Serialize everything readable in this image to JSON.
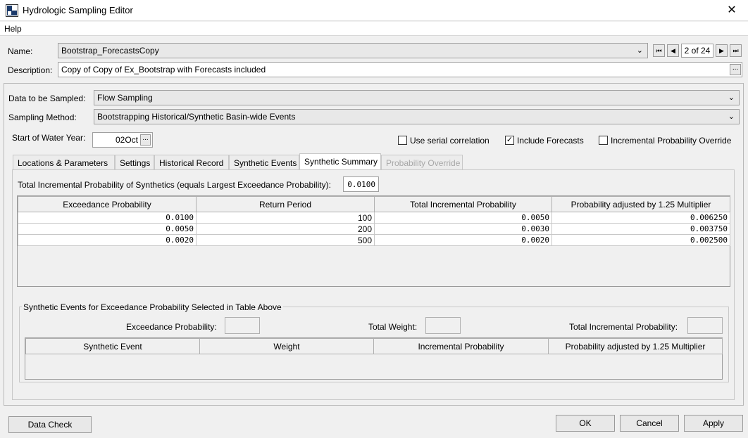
{
  "window": {
    "title": "Hydrologic Sampling Editor",
    "close_glyph": "✕"
  },
  "menu": {
    "help": "Help"
  },
  "header": {
    "name_label": "Name:",
    "name_value": "Bootstrap_ForecastsCopy",
    "description_label": "Description:",
    "description_value": "Copy of Copy of Ex_Bootstrap with Forecasts included",
    "ellipsis": "...",
    "nav_counter": "2 of 24"
  },
  "sampling": {
    "data_label": "Data to be Sampled:",
    "data_value": "Flow Sampling",
    "method_label": "Sampling Method:",
    "method_value": "Bootstrapping Historical/Synthetic Basin-wide Events"
  },
  "water_year": {
    "label": "Start of Water Year:",
    "value": "02Oct",
    "ellipsis": "..."
  },
  "options": {
    "serial_correlation": {
      "label": "Use serial correlation",
      "checked": false
    },
    "include_forecasts": {
      "label": "Include Forecasts",
      "checked": true
    },
    "incremental_override": {
      "label": "Incremental Probability Override",
      "checked": false
    }
  },
  "tabs": [
    {
      "label": "Locations & Parameters"
    },
    {
      "label": "Settings"
    },
    {
      "label": "Historical Record"
    },
    {
      "label": "Synthetic Events"
    },
    {
      "label": "Synthetic Summary"
    },
    {
      "label": "Probability Override"
    }
  ],
  "summary": {
    "total_label": "Total Incremental Probability of Synthetics (equals Largest Exceedance Probability):",
    "total_value": "0.0100",
    "columns": [
      "Exceedance Probability",
      "Return Period",
      "Total Incremental Probability",
      "Probability adjusted by 1.25 Multiplier"
    ],
    "rows": [
      [
        "0.0100",
        "100",
        "0.0050",
        "0.006250"
      ],
      [
        "0.0050",
        "200",
        "0.0030",
        "0.003750"
      ],
      [
        "0.0020",
        "500",
        "0.0020",
        "0.002500"
      ]
    ]
  },
  "events": {
    "group_title": "Synthetic Events for Exceedance Probability Selected in Table Above",
    "exceedance_label": "Exceedance Probability:",
    "weight_label": "Total Weight:",
    "incremental_label": "Total Incremental Probability:",
    "columns": [
      "Synthetic Event",
      "Weight",
      "Incremental Probability",
      "Probability adjusted by 1.25 Multiplier"
    ]
  },
  "footer": {
    "data_check": "Data Check",
    "ok": "OK",
    "cancel": "Cancel",
    "apply": "Apply"
  }
}
